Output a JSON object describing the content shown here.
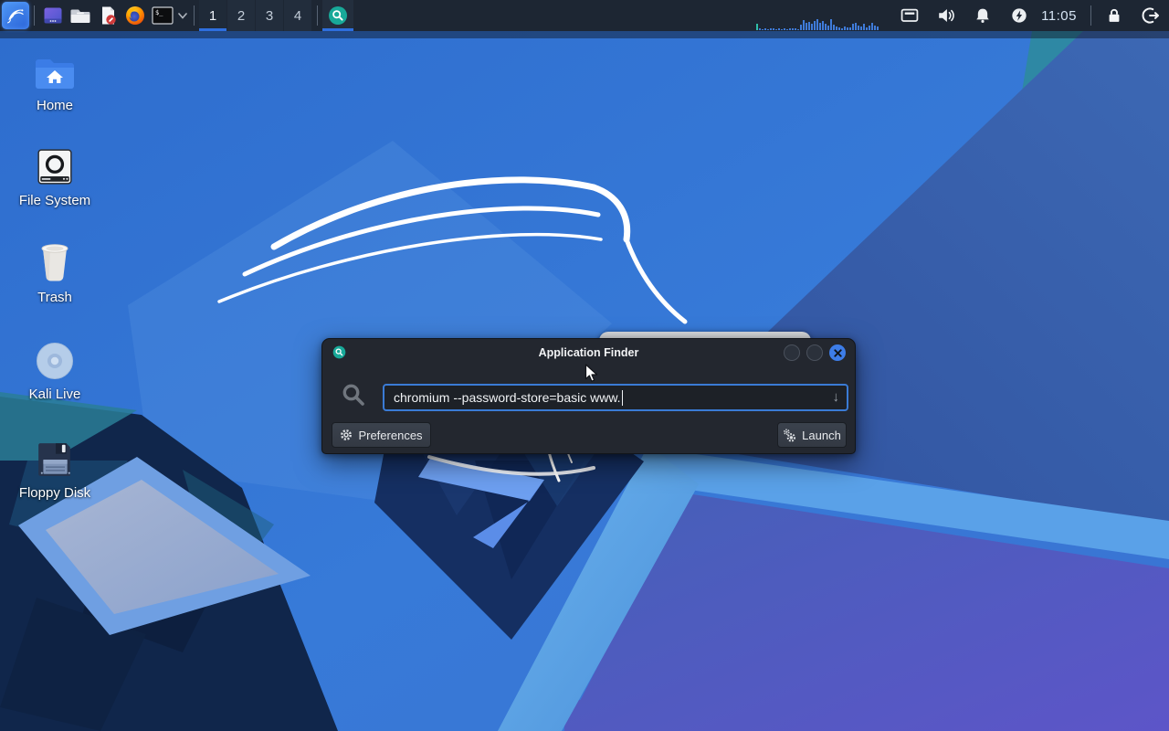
{
  "panel": {
    "menu": {
      "name": "kali-applications-menu"
    },
    "launchers": [
      {
        "name": "settings-app"
      },
      {
        "name": "file-manager"
      },
      {
        "name": "text-editor"
      },
      {
        "name": "firefox-browser"
      },
      {
        "name": "terminal-emulator"
      }
    ],
    "terminal_glyph": "$_",
    "workspaces": [
      {
        "label": "1",
        "active": true
      },
      {
        "label": "2",
        "active": false
      },
      {
        "label": "3",
        "active": false
      },
      {
        "label": "4",
        "active": false
      }
    ],
    "taskbar": [
      {
        "name": "application-finder",
        "active": true
      }
    ],
    "cpu_graph_bars": [
      0.5,
      0.12,
      0.1,
      0.14,
      0.1,
      0.12,
      0.16,
      0.1,
      0.13,
      0.1,
      0.15,
      0.1,
      0.12,
      0.18,
      0.14,
      0.1,
      0.45,
      0.85,
      0.6,
      0.7,
      0.5,
      0.75,
      0.9,
      0.6,
      0.8,
      0.55,
      0.4,
      0.95,
      0.45,
      0.3,
      0.22,
      0.18,
      0.3,
      0.24,
      0.2,
      0.55,
      0.65,
      0.4,
      0.3,
      0.5,
      0.25,
      0.4,
      0.6,
      0.35,
      0.28,
      0.18
    ],
    "clock": "11:05"
  },
  "desktop": {
    "icons": [
      {
        "label": "Home"
      },
      {
        "label": "File System"
      },
      {
        "label": "Trash"
      },
      {
        "label": "Kali Live"
      },
      {
        "label": "Floppy Disk"
      }
    ]
  },
  "finder": {
    "title": "Application Finder",
    "search_value": "chromium --password-store=basic www.",
    "dropdown_glyph": "↓",
    "buttons": {
      "preferences": "Preferences",
      "launch": "Launch"
    }
  },
  "colors": {
    "accent_blue": "#3d7de8",
    "panel_bg": "#1d2633",
    "active_underline": "#2e6fdf",
    "finder_badge_teal": "#18a999"
  }
}
